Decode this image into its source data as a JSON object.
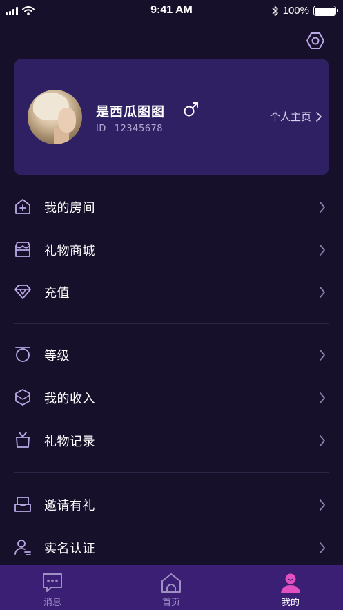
{
  "status_bar": {
    "time": "9:41 AM",
    "battery": "100%"
  },
  "profile": {
    "name": "是西瓜图图",
    "id_label": "ID",
    "id_value": "12345678",
    "homepage_label": "个人主页"
  },
  "menu": {
    "group1": [
      {
        "label": "我的房间",
        "icon": "room-icon"
      },
      {
        "label": "礼物商城",
        "icon": "store-icon"
      },
      {
        "label": "充值",
        "icon": "diamond-icon"
      }
    ],
    "group2": [
      {
        "label": "等级",
        "icon": "level-icon"
      },
      {
        "label": "我的收入",
        "icon": "income-icon"
      },
      {
        "label": "礼物记录",
        "icon": "gift-icon"
      }
    ],
    "group3": [
      {
        "label": "邀请有礼",
        "icon": "invite-icon"
      },
      {
        "label": "实名认证",
        "icon": "verify-icon"
      }
    ]
  },
  "tabs": [
    {
      "label": "消息",
      "icon": "message-icon",
      "active": false
    },
    {
      "label": "首页",
      "icon": "home-icon",
      "active": false
    },
    {
      "label": "我的",
      "icon": "profile-icon",
      "active": true
    }
  ],
  "colors": {
    "background": "#17102b",
    "card": "#2f1f63",
    "tabbar": "#3a1f74",
    "accent_pink": "#e24fc0",
    "icon_stroke": "#b9a9e6"
  }
}
